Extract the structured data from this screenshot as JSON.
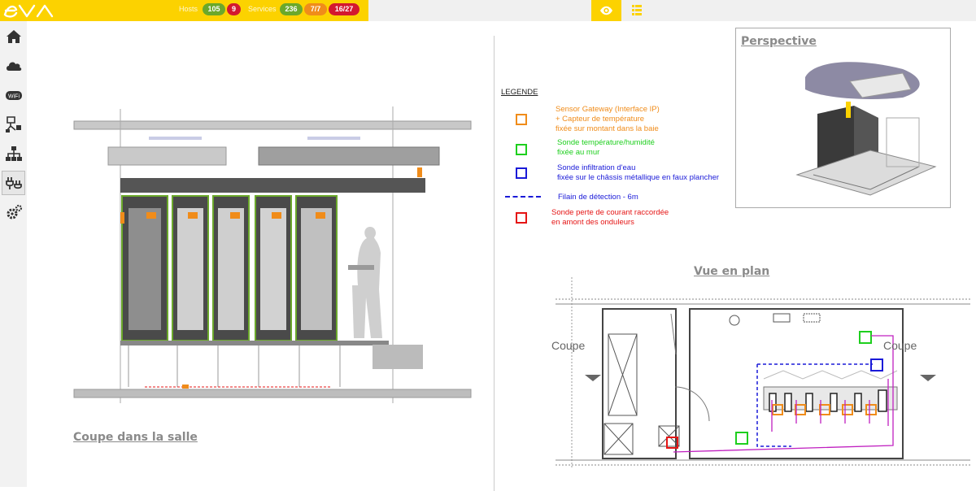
{
  "header": {
    "hosts_label": "Hosts",
    "hosts_ok": "105",
    "hosts_crit": "9",
    "services_label": "Services",
    "services_ok": "236",
    "services_warn": "7/7",
    "services_crit": "16/27"
  },
  "tabs": {
    "view": "eye-icon",
    "list": "list-icon"
  },
  "sidebar": {
    "items": [
      {
        "icon": "home-icon"
      },
      {
        "icon": "cloud-icon"
      },
      {
        "icon": "wifi-icon"
      },
      {
        "icon": "network-share-icon"
      },
      {
        "icon": "sitemap-icon"
      },
      {
        "icon": "power-plug-icon"
      },
      {
        "icon": "gears-icon"
      }
    ]
  },
  "drawing": {
    "section_title": "Coupe dans la salle",
    "perspective_title": "Perspective",
    "plan_title": "Vue en plan",
    "coupe_left": "Coupe",
    "coupe_right": "Coupe"
  },
  "legend": {
    "title": "LEGENDE",
    "gateway_line1": "Sensor Gateway (Interface IP)",
    "gateway_line2": "+ Capteur de température",
    "gateway_line3": "fixée sur montant dans la baie",
    "temp_line1": "Sonde température/humidité",
    "temp_line2": "fixée au mur",
    "water_line1": "Sonde infiltration d'eau",
    "water_line2": "fixée sur le châssis métallique en faux plancher",
    "cable": "Filain de détection - 6m",
    "power_line1": "Sonde perte de courant raccordée",
    "power_line2": "en amont des onduleurs"
  },
  "colors": {
    "brand": "#fcd200",
    "ok": "#6ba82b",
    "critical": "#d3182f",
    "warning": "#f08c1a",
    "gateway": "#f08c1a",
    "temp": "#1ecf1e",
    "water": "#1a1ad8",
    "power": "#e51515",
    "cable": "#c020c0"
  }
}
